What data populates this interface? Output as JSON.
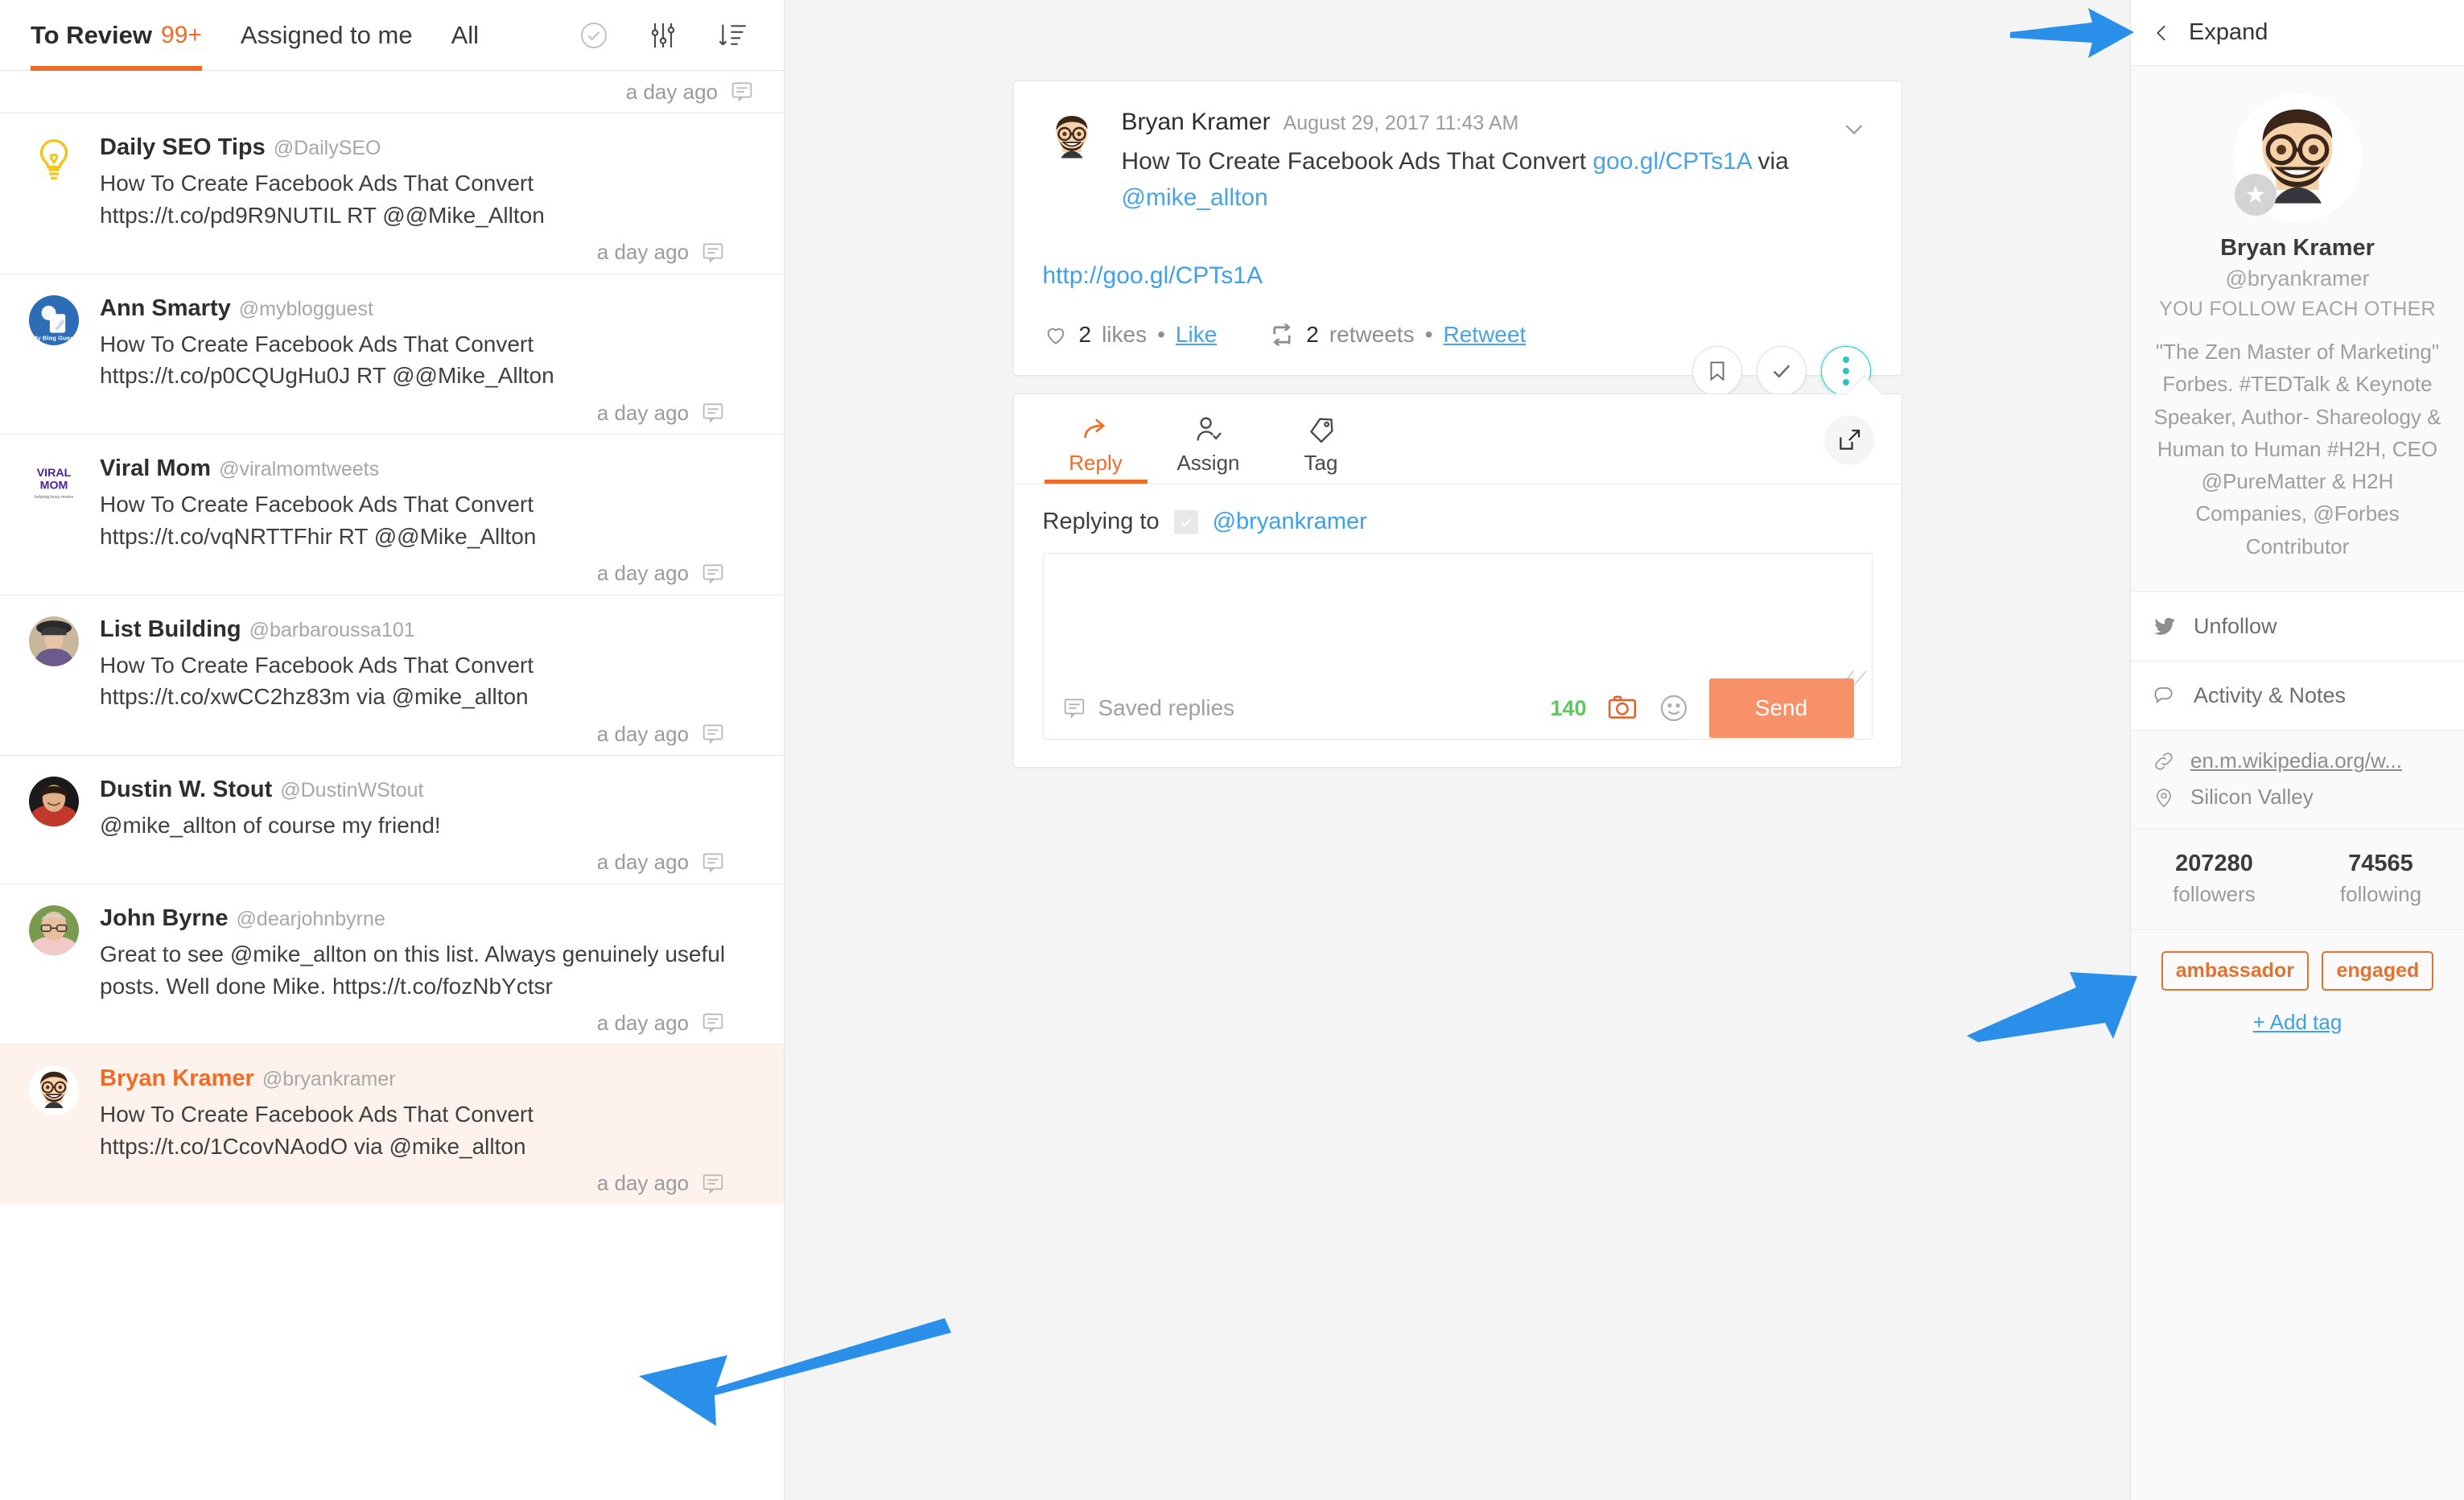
{
  "left_panel": {
    "tabs": [
      {
        "label": "To Review",
        "badge": "99+",
        "active": true
      },
      {
        "label": "Assigned to me",
        "badge": "",
        "active": false
      },
      {
        "label": "All",
        "badge": "",
        "active": false
      }
    ],
    "toolbar_icons": [
      "check-circle-icon",
      "filter-sliders-icon",
      "sort-descending-icon"
    ],
    "items": [
      {
        "name": "Daily SEO Tips",
        "handle": "@DailySEO",
        "text": "How To Create Facebook Ads That Convert https://t.co/pd9R9NUTIL RT @@Mike_Allton",
        "time": "a day ago",
        "selected": false,
        "avatar_kind": "bulb"
      },
      {
        "name": "Ann Smarty",
        "handle": "@myblogguest",
        "text": "How To Create Facebook Ads That Convert https://t.co/p0CQUgHu0J RT @@Mike_Allton",
        "time": "a day ago",
        "selected": false,
        "avatar_kind": "blueblog"
      },
      {
        "name": "Viral Mom",
        "handle": "@viralmomtweets",
        "text": "How To Create Facebook Ads That Convert https://t.co/vqNRTTFhir RT @@Mike_Allton",
        "time": "a day ago",
        "selected": false,
        "avatar_kind": "viralmom"
      },
      {
        "name": "List Building",
        "handle": "@barbaroussa101",
        "text": "How To Create Facebook Ads That Convert https://t.co/xwCC2hz83m via @mike_allton",
        "time": "a day ago",
        "selected": false,
        "avatar_kind": "woman"
      },
      {
        "name": "Dustin W. Stout",
        "handle": "@DustinWStout",
        "text": "@mike_allton of course my friend!",
        "time": "a day ago",
        "selected": false,
        "avatar_kind": "dustin"
      },
      {
        "name": "John Byrne",
        "handle": "@dearjohnbyrne",
        "text": "Great to see @mike_allton on this list. Always genuinely useful posts. Well done Mike. https://t.co/fozNbYctsr",
        "time": "a day ago",
        "selected": false,
        "avatar_kind": "john"
      },
      {
        "name": "Bryan Kramer",
        "handle": "@bryankramer",
        "text": "How To Create Facebook Ads That Convert https://t.co/1CcovNAodO via @mike_allton",
        "time": "a day ago",
        "selected": true,
        "avatar_kind": "bryan"
      }
    ],
    "top_time": "a day ago"
  },
  "tweet": {
    "author": "Bryan Kramer",
    "date": "August 29, 2017 11:43 AM",
    "text_before": "How To Create Facebook Ads That Convert ",
    "link_short": "goo.gl/CPTs1A",
    "text_mid": " via ",
    "mention": "@mike_allton",
    "preview_url": "http://goo.gl/CPTs1A",
    "likes_count": "2",
    "likes_label": "likes",
    "like_action": "Like",
    "retweets_count": "2",
    "retweets_label": "retweets",
    "retweet_action": "Retweet",
    "separator": "•",
    "actions": [
      "bookmark-icon",
      "check-icon",
      "more-options-icon"
    ]
  },
  "compose": {
    "tabs": [
      {
        "label": "Reply",
        "icon": "reply-arrow-icon",
        "active": true
      },
      {
        "label": "Assign",
        "icon": "assign-person-icon",
        "active": false
      },
      {
        "label": "Tag",
        "icon": "tag-icon",
        "active": false
      }
    ],
    "popout_icon": "open-external-icon",
    "replying_to_label": "Replying to",
    "replying_to_handle": "@bryankramer",
    "textarea_value": "",
    "textarea_placeholder": "",
    "saved_replies_label": "Saved replies",
    "char_count": "140",
    "camera_icon": "camera-icon",
    "emoji_icon": "emoji-smiley-icon",
    "send_label": "Send"
  },
  "right_panel": {
    "expand_label": "Expand",
    "back_icon": "chevron-left-icon",
    "profile": {
      "name": "Bryan Kramer",
      "handle": "@bryankramer",
      "relationship": "YOU FOLLOW EACH OTHER",
      "bio": "\"The Zen Master of Marketing\" Forbes. #TEDTalk & Keynote Speaker, Author- Shareology & Human to Human #H2H, CEO @PureMatter & H2H Companies, @Forbes Contributor",
      "badge_icon": "star-icon"
    },
    "rows": [
      {
        "label": "Unfollow",
        "icon": "twitter-bird-icon"
      },
      {
        "label": "Activity & Notes",
        "icon": "speech-bubble-icon"
      }
    ],
    "meta": {
      "website": "en.m.wikipedia.org/w...",
      "website_icon": "link-icon",
      "location": "Silicon Valley",
      "location_icon": "map-pin-icon"
    },
    "counts": [
      {
        "value": "207280",
        "label": "followers"
      },
      {
        "value": "74565",
        "label": "following"
      }
    ],
    "tags": [
      "ambassador",
      "engaged"
    ],
    "add_tag_label": "+ Add tag"
  },
  "colors": {
    "accent_orange": "#ef6c28",
    "send_orange": "#f79268",
    "link_blue": "#4aa3e3",
    "teal": "#2ec4c4",
    "tag_orange": "#e2732f",
    "count_green": "#5fc75f",
    "annotation_blue": "#2a8fe8"
  }
}
